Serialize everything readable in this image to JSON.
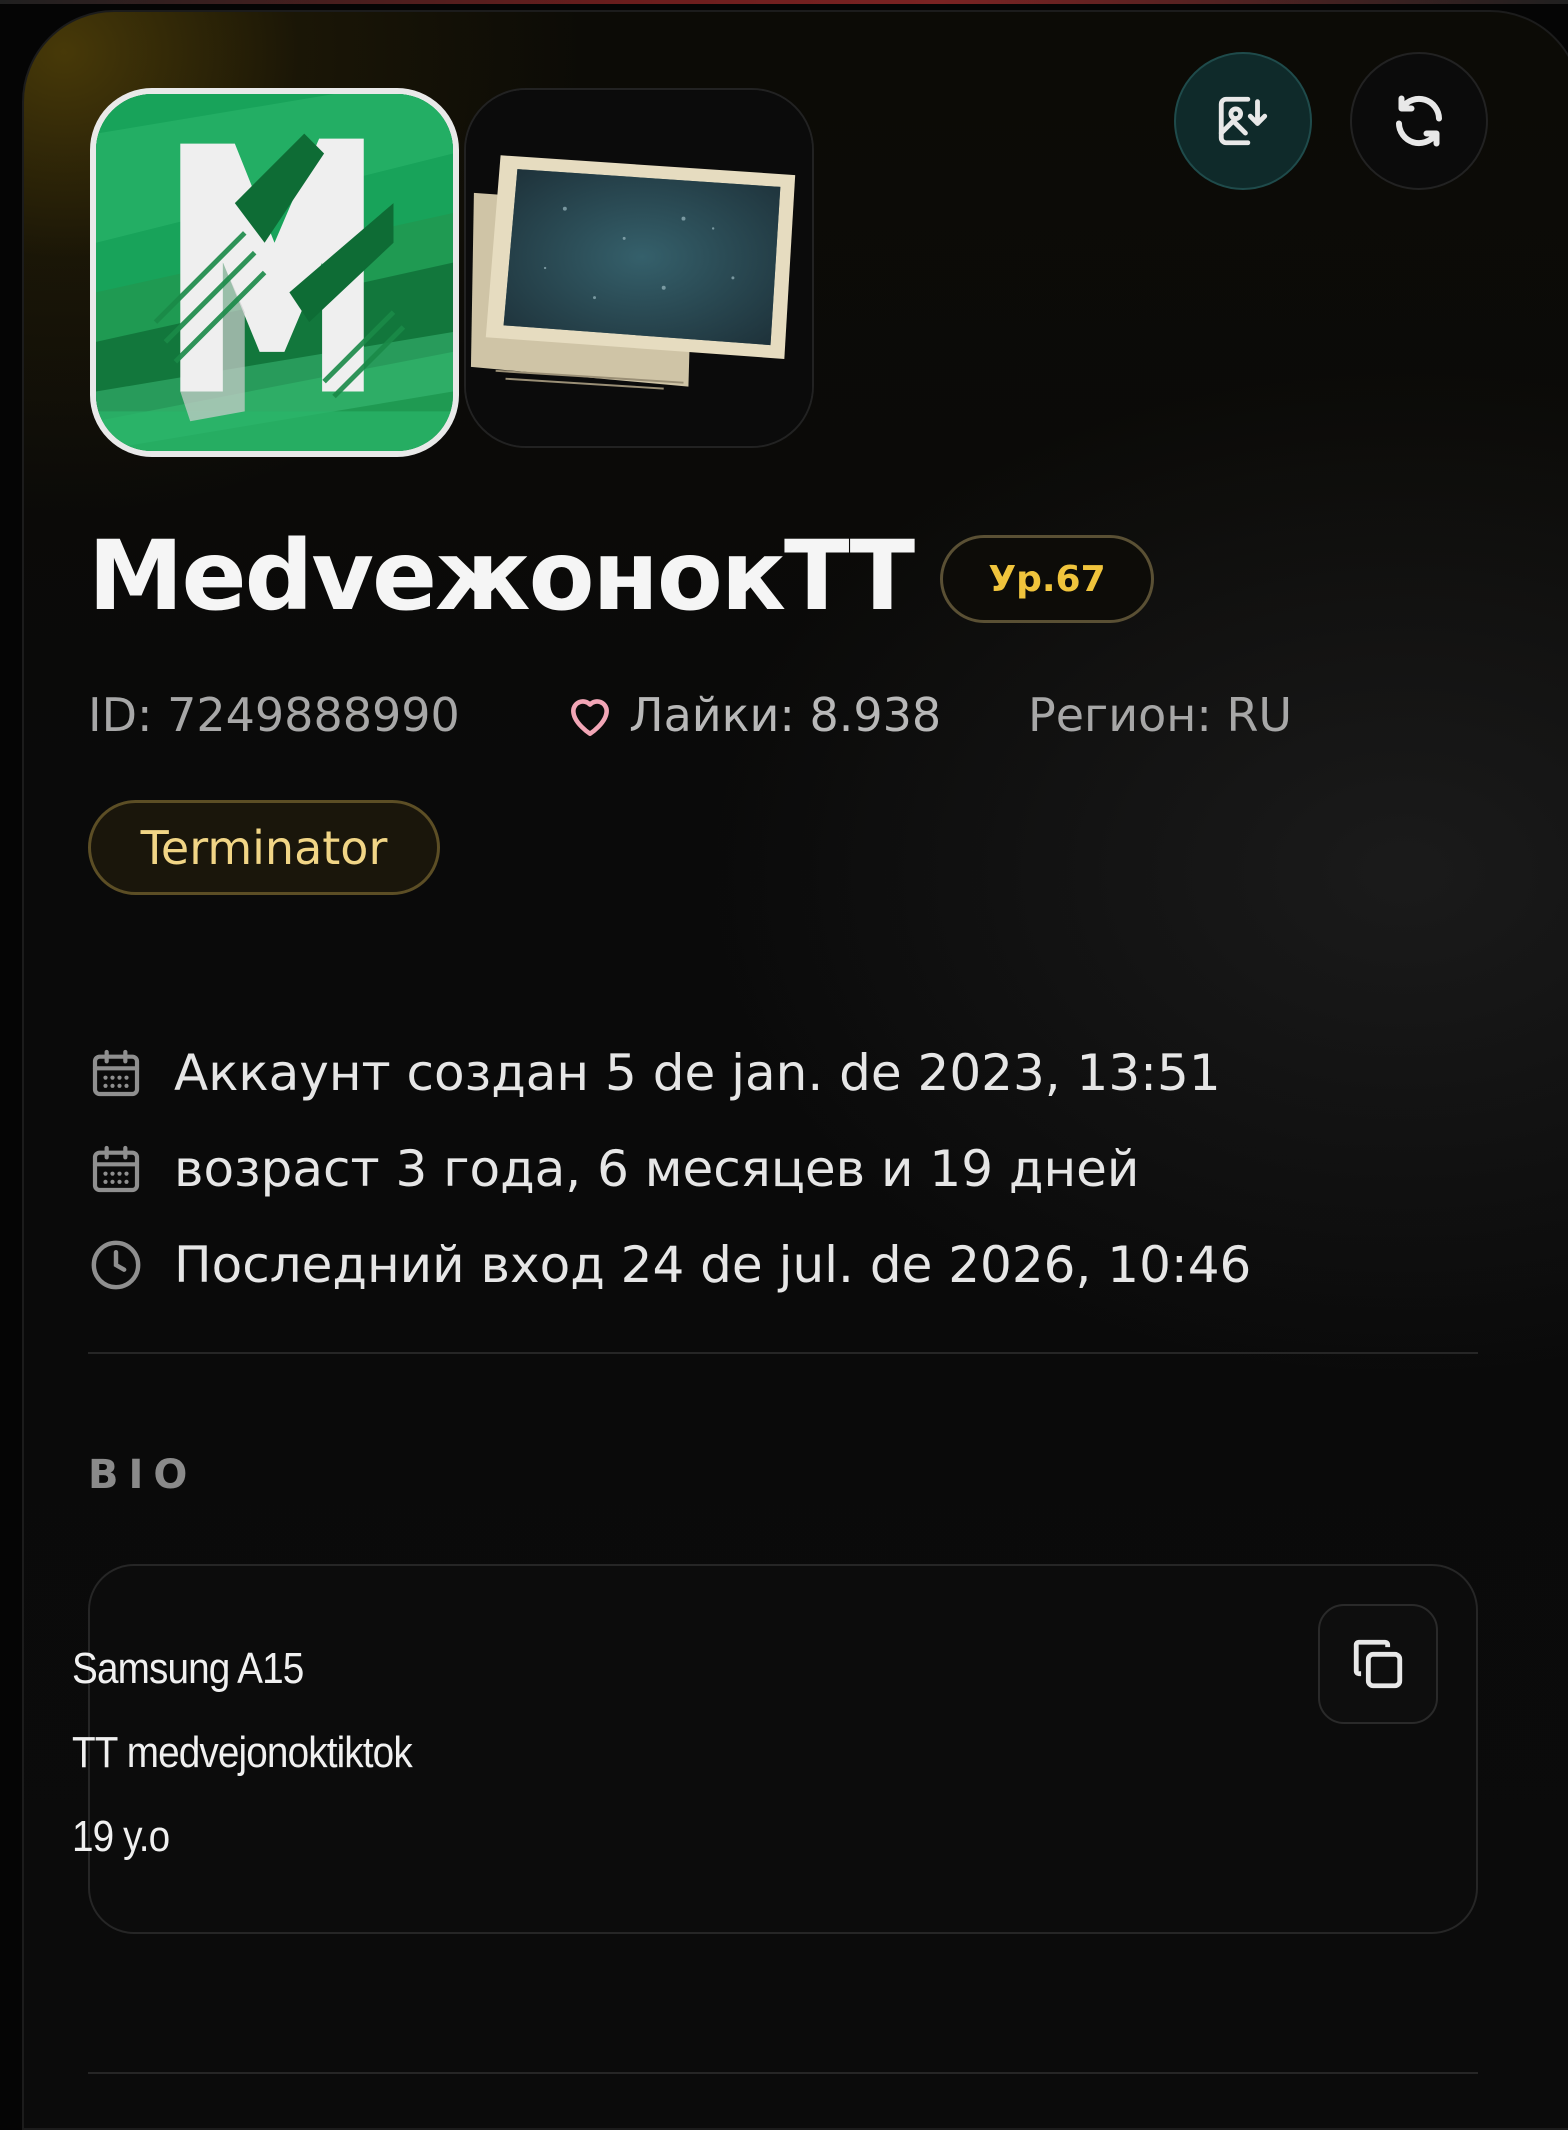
{
  "profile": {
    "name": "MedvежонокTT",
    "level": "Ур.67",
    "id_text": "ID: 7249888990",
    "likes_text": "Лайки: 8.938",
    "region_text": "Регион: RU",
    "tag": "Terminator"
  },
  "info": {
    "created": "Аккаунт создан 5 de jan. de 2023, 13:51",
    "age": "возраст 3 года, 6 месяцев и 19 дней",
    "last_login": "Последний вход 24 de jul. de 2026, 10:46"
  },
  "bio": {
    "label": "BIO",
    "lines": [
      "Samsung A15",
      "TT medvejonoktiktok",
      "19 y.o"
    ]
  },
  "icons": {
    "download_image": "image-download-icon",
    "refresh": "refresh-icon",
    "heart": "heart-icon",
    "calendar": "calendar-icon",
    "clock": "clock-icon",
    "copy": "copy-icon"
  },
  "colors": {
    "level_text": "#f0c43c",
    "tag_text": "#f1d586",
    "heart": "#f2a6b6",
    "accent_button": "#0f2a2a"
  }
}
